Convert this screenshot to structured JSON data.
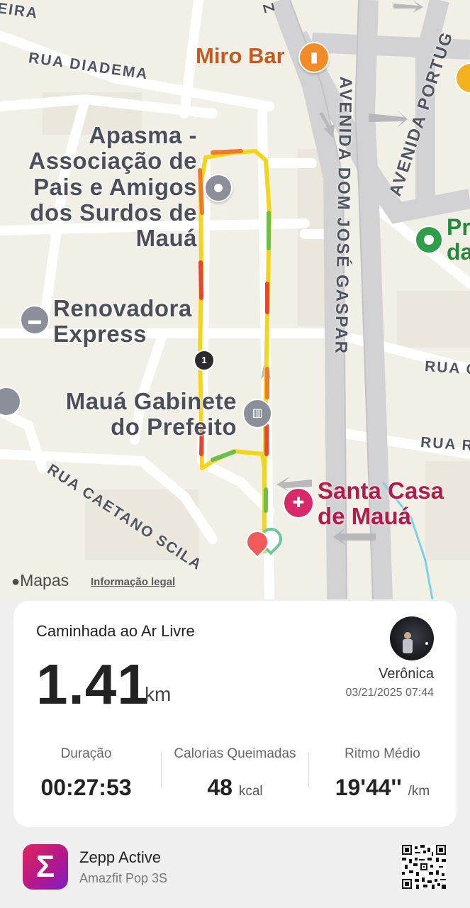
{
  "map": {
    "streets": {
      "top_left": "EIRA",
      "diadema": "RUA DIADEMA",
      "dom_jose": "AVENIDA DOM JOSÉ GASPAR",
      "portugal": "AVENIDA PORTUG",
      "caetano": "RUA CAETANO SCILA",
      "top_z": "Z",
      "rua_right1": "RUA C",
      "rua_right2": "RUA R"
    },
    "pois": {
      "miro_bar": "Miro Bar",
      "apasma": "Apasma -\nAssociação de\nPais e Amigos\ndos Surdos de\nMauá",
      "renovadora": "Renovadora\nExpress",
      "gabinete": "Mauá Gabinete\ndo Prefeito",
      "santa_casa": "Santa Casa\nde Mauá",
      "green_poi": "Pr\nda"
    },
    "split_marker": "1",
    "attribution": "Mapas",
    "legal": "Informação legal",
    "colors": {
      "route_yellow": "#f2d51c",
      "route_red": "#e8452c",
      "route_green": "#6cc04a",
      "orange_poi": "#f28c28",
      "pink_poi": "#d8296a"
    }
  },
  "card": {
    "activity_title": "Caminhada ao Ar Livre",
    "distance": "1.41",
    "distance_unit": "km",
    "user_name": "Verônica",
    "datetime": "03/21/2025 07:44",
    "stats": [
      {
        "label": "Duração",
        "value": "00:27:53",
        "unit": ""
      },
      {
        "label": "Calorias Queimadas",
        "value": "48",
        "unit": "kcal"
      },
      {
        "label": "Ritmo Médio",
        "value": "19'44''",
        "unit": "/km"
      }
    ]
  },
  "footer": {
    "app_name": "Zepp Active",
    "device": "Amazfit Pop 3S",
    "app_icon_glyph": "Σ"
  }
}
